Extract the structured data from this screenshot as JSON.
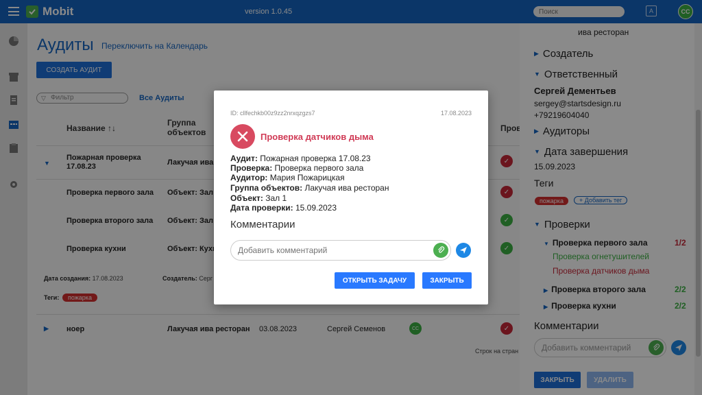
{
  "topbar": {
    "app_name": "Mobit",
    "version": "version 1.0.45",
    "search_placeholder": "Поиск",
    "avatar": "CC"
  },
  "main": {
    "title": "Аудиты",
    "switch_link": "Переключить на Календарь",
    "create_button": "СОЗДАТЬ АУДИТ",
    "filter_placeholder": "Фильтр",
    "all_audits": "Все Аудиты",
    "columns": {
      "name": "Название",
      "group_line1": "Группа",
      "group_line2": "объектов",
      "checks": "Пров"
    },
    "audit1": {
      "name_line1": "Пожарная проверка",
      "name_line2": "17.08.23",
      "group": "Лакучая ива р"
    },
    "sub_rows": [
      {
        "name": "Проверка первого зала",
        "object": "Объект: Зал 1",
        "status": "red"
      },
      {
        "name": "Проверка второго зала",
        "object": "Объект: Зал 2",
        "status": "green"
      },
      {
        "name": "Проверка кухни",
        "object": "Объект: Кухн",
        "status": "green"
      }
    ],
    "created_label": "Дата создания:",
    "created_value": "17.08.2023",
    "creator_label": "Создатель:",
    "creator_value": "Серг",
    "tags_label": "Теги:",
    "tag": "пожарка",
    "audit2": {
      "name": "ноер",
      "group": "Лакучая ива ресторан",
      "date": "03.08.2023",
      "person": "Сергей Семенов",
      "avatar": "CC"
    },
    "rows_per_page": "Строк на стран"
  },
  "panel": {
    "top_line": "ива ресторан",
    "creator": "Создатель",
    "responsible": "Ответственный",
    "resp_name": "Сергей Дементьев",
    "resp_email": "sergey@startsdesign.ru",
    "resp_phone": "+79219604040",
    "auditors": "Аудиторы",
    "end_date_label": "Дата завершения",
    "end_date": "15.09.2023",
    "tags": "Теги",
    "tag": "пожарка",
    "add_tag": "+ Добавить тег",
    "checks": "Проверки",
    "check_items": [
      {
        "label": "Проверка первого зала",
        "ratio": "1/2",
        "ratio_color": "#c62839"
      },
      {
        "label": "Проверка второго зала",
        "ratio": "2/2",
        "ratio_color": "#3cb043"
      },
      {
        "label": "Проверка кухни",
        "ratio": "2/2",
        "ratio_color": "#3cb043"
      }
    ],
    "sub_items": [
      {
        "label": "Проверка огнетушителей",
        "color": "#3cb043"
      },
      {
        "label": "Проверка датчиков дыма",
        "color": "#c62839"
      }
    ],
    "comments": "Комментарии",
    "comment_placeholder": "Добавить комментарий",
    "close_button": "ЗАКРЫТЬ",
    "delete_button": "УДАЛИТЬ"
  },
  "modal": {
    "id": "ID: cllfechkb00z9zz2nrxqzgzs7",
    "date": "17.08.2023",
    "title": "Проверка датчиков дыма",
    "fields": [
      {
        "label": "Аудит:",
        "value": "Пожарная проверка 17.08.23"
      },
      {
        "label": "Проверка:",
        "value": "Проверка первого зала"
      },
      {
        "label": "Аудитор:",
        "value": "Мария Пожарицкая"
      },
      {
        "label": "Группа объектов:",
        "value": "Лакучая ива ресторан"
      },
      {
        "label": "Объект:",
        "value": "Зал 1"
      },
      {
        "label": "Дата проверки:",
        "value": "15.09.2023"
      }
    ],
    "comments_title": "Комментарии",
    "comment_placeholder": "Добавить комментарий",
    "open_task_button": "ОТКРЫТЬ ЗАДАЧУ",
    "close_button": "ЗАКРЫТЬ"
  }
}
